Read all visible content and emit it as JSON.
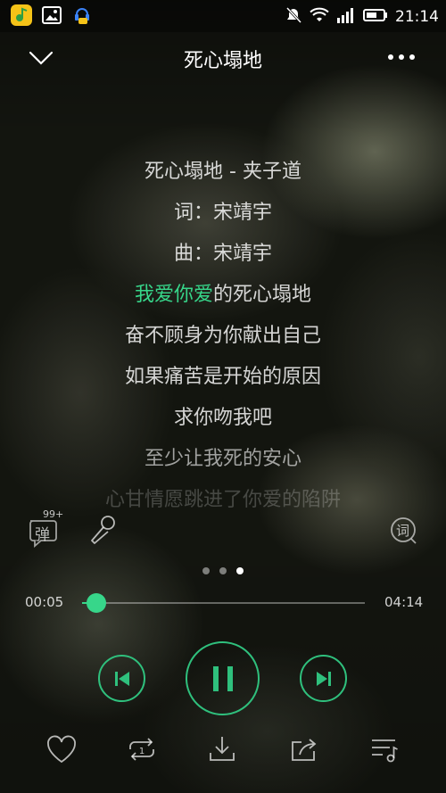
{
  "status_bar": {
    "time": "21:14",
    "icons": [
      "qq-music-app-icon",
      "gallery-app-icon",
      "chat-app-icon",
      "mute-icon",
      "wifi-icon",
      "signal-icon",
      "battery-icon"
    ]
  },
  "header": {
    "title": "死心塌地"
  },
  "lyrics": {
    "lines": [
      {
        "text": "死心塌地 - 夹子道"
      },
      {
        "text": "词：宋靖宇"
      },
      {
        "text": "曲：宋靖宇"
      },
      {
        "highlight": "我爱你爱",
        "rest": "的死心塌地"
      },
      {
        "text": "奋不顾身为你献出自己"
      },
      {
        "text": "如果痛苦是开始的原因"
      },
      {
        "text": "求你吻我吧"
      },
      {
        "text": "至少让我死的安心"
      },
      {
        "text": "心甘情愿跳进了你爱的陷阱"
      }
    ]
  },
  "tools": {
    "danmu_label": "弹",
    "danmu_badge": "99+",
    "lyric_label": "词"
  },
  "pager": {
    "count": 3,
    "active": 3
  },
  "progress": {
    "current": "00:05",
    "total": "04:14",
    "fraction": 0.05
  },
  "colors": {
    "accent": "#37d68a",
    "background": "#141610"
  }
}
